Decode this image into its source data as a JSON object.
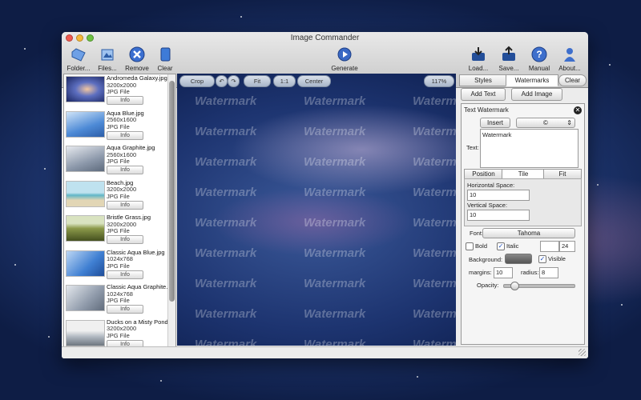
{
  "window": {
    "title": "Image Commander"
  },
  "toolbar": {
    "folder": "Folder...",
    "files": "Files...",
    "remove": "Remove",
    "clear": "Clear",
    "generate": "Generate",
    "load": "Load...",
    "save": "Save...",
    "manual": "Manual",
    "about": "About..."
  },
  "files": [
    {
      "name": "Andromeda Galaxy.jpg",
      "size": "3200x2000",
      "type": "JPG File",
      "info": "Info"
    },
    {
      "name": "Aqua Blue.jpg",
      "size": "2560x1600",
      "type": "JPG File",
      "info": "Info"
    },
    {
      "name": "Aqua Graphite.jpg",
      "size": "2560x1600",
      "type": "JPG File",
      "info": "Info"
    },
    {
      "name": "Beach.jpg",
      "size": "3200x2000",
      "type": "JPG File",
      "info": "Info"
    },
    {
      "name": "Bristle Grass.jpg",
      "size": "3200x2000",
      "type": "JPG File",
      "info": "Info"
    },
    {
      "name": "Classic Aqua Blue.jpg",
      "size": "1024x768",
      "type": "JPG File",
      "info": "Info"
    },
    {
      "name": "Classic Aqua Graphite.",
      "size": "1024x768",
      "type": "JPG File",
      "info": "Info"
    },
    {
      "name": "Ducks on a Misty Pond",
      "size": "3200x2000",
      "type": "JPG File",
      "info": "Info"
    }
  ],
  "canvas": {
    "crop": "Crop",
    "fit": "Fit",
    "one_to_one": "1:1",
    "center": "Center",
    "zoom": "117%",
    "watermark": "Watermark"
  },
  "panel": {
    "tab_styles": "Styles",
    "tab_watermarks": "Watermarks",
    "clear": "Clear",
    "add_text": "Add Text",
    "add_image": "Add Image",
    "wm_title": "Text Watermark",
    "insert": "Insert",
    "symbol": "©",
    "text_label": "Text:",
    "text_value": "Watermark",
    "sub_position": "Position",
    "sub_tile": "Tile",
    "sub_fit": "Fit",
    "hspace_label": "Horizontal Space:",
    "hspace": "10",
    "vspace_label": "Vertical Space:",
    "vspace": "10",
    "font_label": "Font:",
    "font": "Tahoma",
    "bold": "Bold",
    "italic": "Italic",
    "font_size": "24",
    "background_label": "Background:",
    "visible": "Visible",
    "margins_label": "margins:",
    "margins": "10",
    "radius_label": "radius:",
    "radius": "8",
    "opacity_label": "Opacity:",
    "opacity": 0.1
  },
  "colors": {
    "accent": "#3d6fd1",
    "canvas_bg": "#24408a"
  }
}
